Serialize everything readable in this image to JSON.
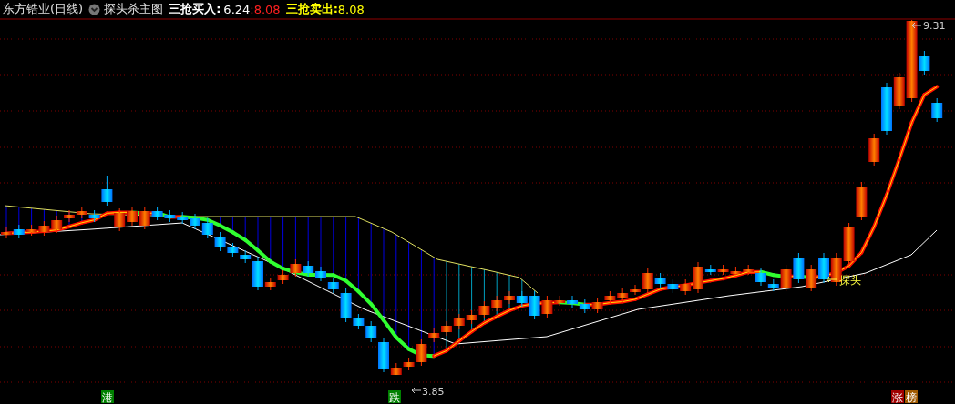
{
  "header": {
    "title": "东方锆业(日线)",
    "indicator": "探头杀主图",
    "values": [
      {
        "text": "三抢买入:",
        "color": "#ffffff"
      },
      {
        "text": "6.24",
        "color": "#ffffff"
      },
      {
        "text": ":8.08",
        "color": "#ff2020"
      },
      {
        "text": "三抢卖出:",
        "color": "#ffff00"
      },
      {
        "text": "8.08",
        "color": "#ffff00"
      }
    ]
  },
  "chart": {
    "high_label": "9.31",
    "low_label": "3.85",
    "signal_label": "探头"
  },
  "markers": [
    {
      "text": "港",
      "color": "#008000"
    },
    {
      "text": "跌",
      "color": "#008000"
    },
    {
      "text": "涨",
      "color": "#a00000"
    },
    {
      "text": "榜",
      "color": "#a05a00"
    }
  ]
}
